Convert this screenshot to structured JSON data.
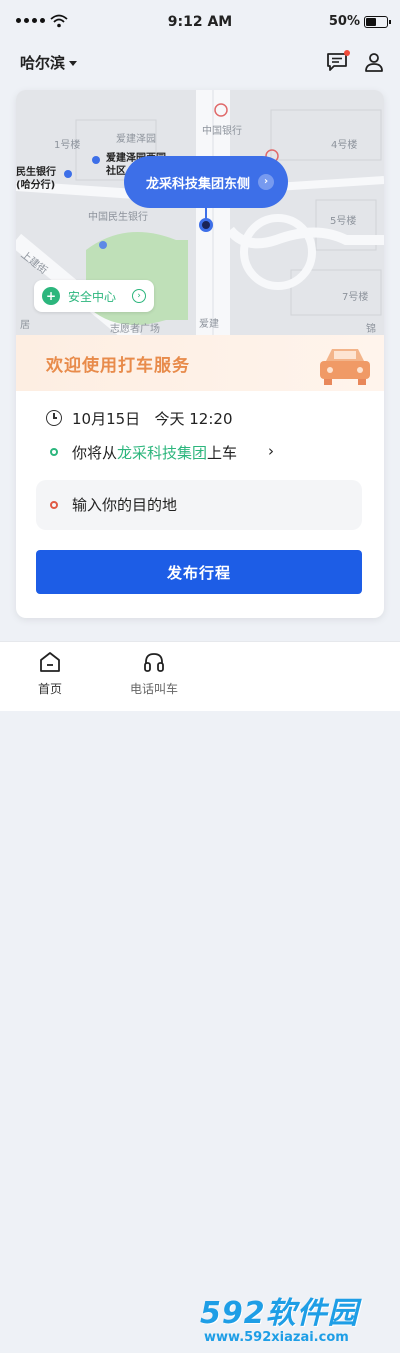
{
  "status_bar": {
    "time": "9:12 AM",
    "battery": "50%"
  },
  "header": {
    "city": "哈尔滨"
  },
  "map": {
    "pickup_label": "龙采科技集团东侧",
    "labels": [
      "1号楼",
      "爱建泽园",
      "中国银行",
      "4号楼",
      "中国民生银行",
      "5号楼",
      "7号楼",
      "上建街",
      "志愿者广场",
      "爱建",
      "锦",
      "居"
    ],
    "poi_1": "爱建泽园西园",
    "poi_1_line2": "社区",
    "poi_2": "民生银行",
    "poi_2_line2": "(哈分行)",
    "safety_center": "安全中心"
  },
  "welcome": {
    "text": "欢迎使用打车服务"
  },
  "trip": {
    "date": "10月15日",
    "time": "今天 12:20",
    "start_prefix": "你将从",
    "start_place": "龙采科技集团",
    "start_suffix": "上车",
    "dest_placeholder": "输入你的目的地",
    "publish_label": "发布行程"
  },
  "tabs": [
    {
      "label": "首页"
    },
    {
      "label": "电话叫车"
    }
  ],
  "watermark": {
    "brand": "592软件园",
    "url": "www.592xiazai.com"
  },
  "colors": {
    "primary": "#1d5de6",
    "green": "#2cb67d",
    "orange": "#e88b4b"
  }
}
